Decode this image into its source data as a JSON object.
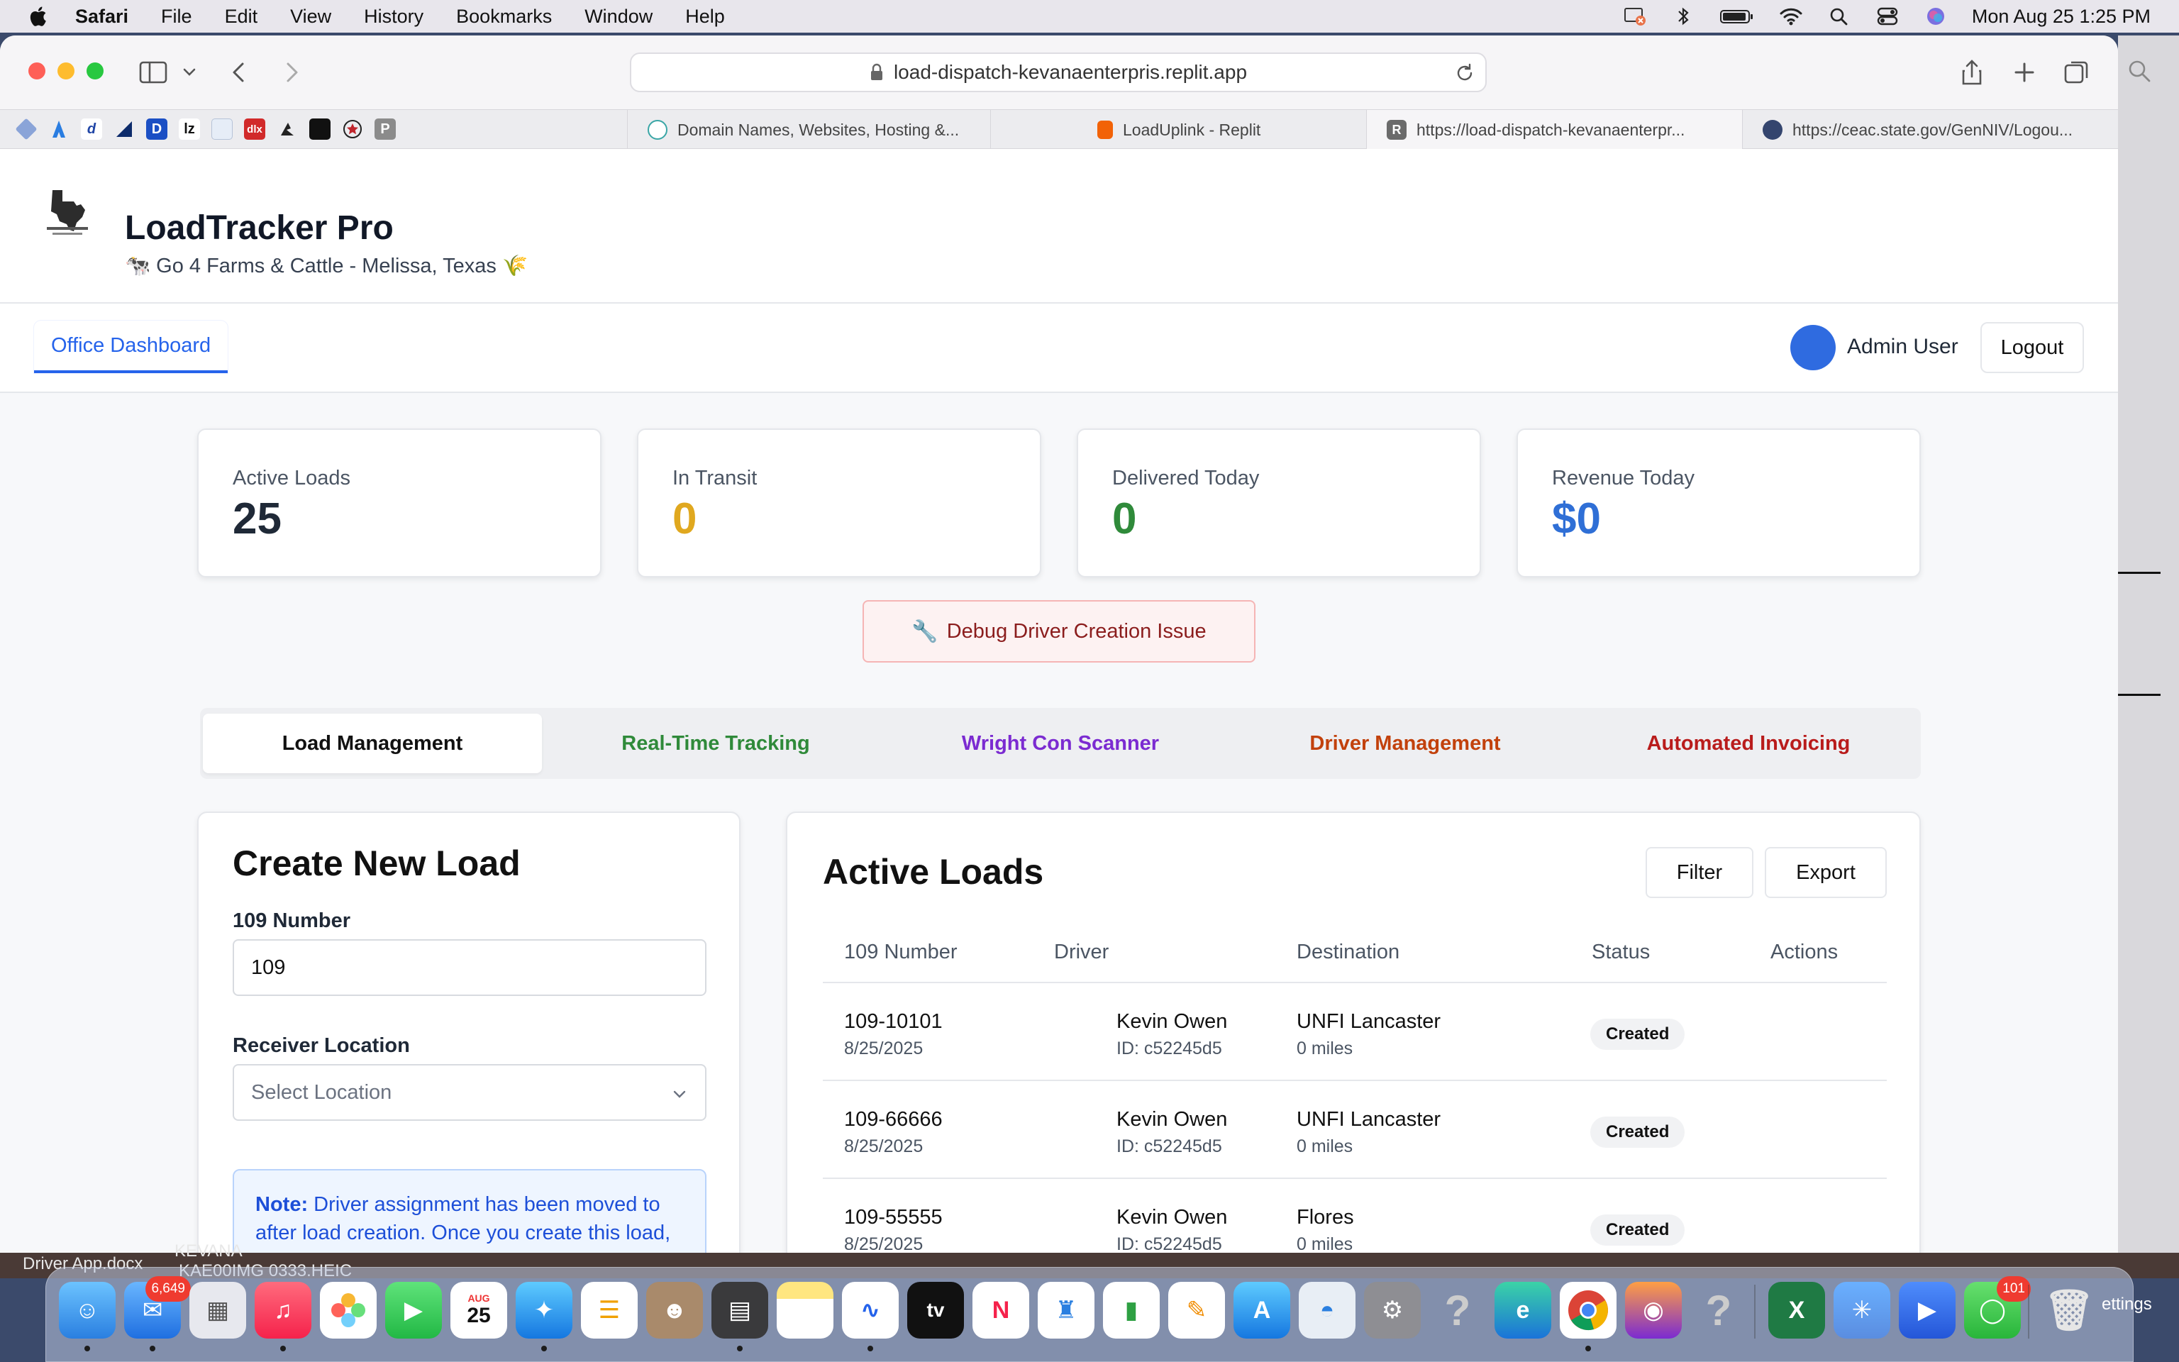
{
  "menubar": {
    "app_name": "Safari",
    "items": [
      "File",
      "Edit",
      "View",
      "History",
      "Bookmarks",
      "Window",
      "Help"
    ],
    "datetime": "Mon Aug 25  1:25 PM"
  },
  "browser": {
    "url": "load-dispatch-kevanaenterpris.replit.app",
    "tabs": [
      {
        "title": "Domain Names, Websites, Hosting &..."
      },
      {
        "title": "LoadUplink - Replit"
      },
      {
        "title": "https://load-dispatch-kevanaenterpr..."
      },
      {
        "title": "https://ceac.state.gov/GenNIV/Logou..."
      }
    ],
    "favorites": [
      "d",
      "D",
      "lz",
      "dlx",
      "P"
    ]
  },
  "app": {
    "title": "LoadTracker Pro",
    "subtitle": "🐄 Go 4 Farms & Cattle - Melissa, Texas 🌾",
    "nav_tab": "Office Dashboard",
    "user_name": "Admin User",
    "logout_label": "Logout"
  },
  "stats": [
    {
      "label": "Active Loads",
      "value": "25",
      "color": "#1f2937"
    },
    {
      "label": "In Transit",
      "value": "0",
      "color": "#e0a81f"
    },
    {
      "label": "Delivered Today",
      "value": "0",
      "color": "#2f8a3a"
    },
    {
      "label": "Revenue Today",
      "value": "$0",
      "color": "#2f6fd6"
    }
  ],
  "debug_button": "Debug Driver Creation Issue",
  "section_tabs": [
    {
      "label": "Load Management",
      "color": "#111111"
    },
    {
      "label": "Real-Time Tracking",
      "color": "#2f8a3a"
    },
    {
      "label": "Wright Con Scanner",
      "color": "#7b2bd1"
    },
    {
      "label": "Driver Management",
      "color": "#c2410c"
    },
    {
      "label": "Automated Invoicing",
      "color": "#b91c1c"
    }
  ],
  "create_load": {
    "title": "Create New Load",
    "number_label": "109 Number",
    "number_value": "109",
    "receiver_label": "Receiver Location",
    "receiver_placeholder": "Select Location",
    "note_bold": "Note:",
    "note_text": " Driver assignment has been moved to after load creation. Once you create this load, you can assign a driver from the loads table."
  },
  "active_loads": {
    "title": "Active Loads",
    "filter_label": "Filter",
    "export_label": "Export",
    "columns": [
      "109 Number",
      "Driver",
      "Destination",
      "Status",
      "Actions"
    ],
    "rows": [
      {
        "number": "109-10101",
        "date": "8/25/2025",
        "driver": "Kevin Owen",
        "driver_id": "ID: c52245d5",
        "destination": "UNFI Lancaster",
        "miles": "0 miles",
        "status": "Created"
      },
      {
        "number": "109-66666",
        "date": "8/25/2025",
        "driver": "Kevin Owen",
        "driver_id": "ID: c52245d5",
        "destination": "UNFI Lancaster",
        "miles": "0 miles",
        "status": "Created"
      },
      {
        "number": "109-55555",
        "date": "8/25/2025",
        "driver": "Kevin Owen",
        "driver_id": "ID: c52245d5",
        "destination": "Flores",
        "miles": "0 miles",
        "status": "Created"
      }
    ]
  },
  "desktop": {
    "file1": "Driver App.docx",
    "file2": "KEVANA",
    "file3": "KAE00IMG 0333.HEIC"
  },
  "dock": {
    "mail_badge": "6,649",
    "calendar_month": "AUG",
    "calendar_day": "25",
    "tv_label": "tv",
    "messages_badge": "101",
    "settings_label": "ettings"
  }
}
